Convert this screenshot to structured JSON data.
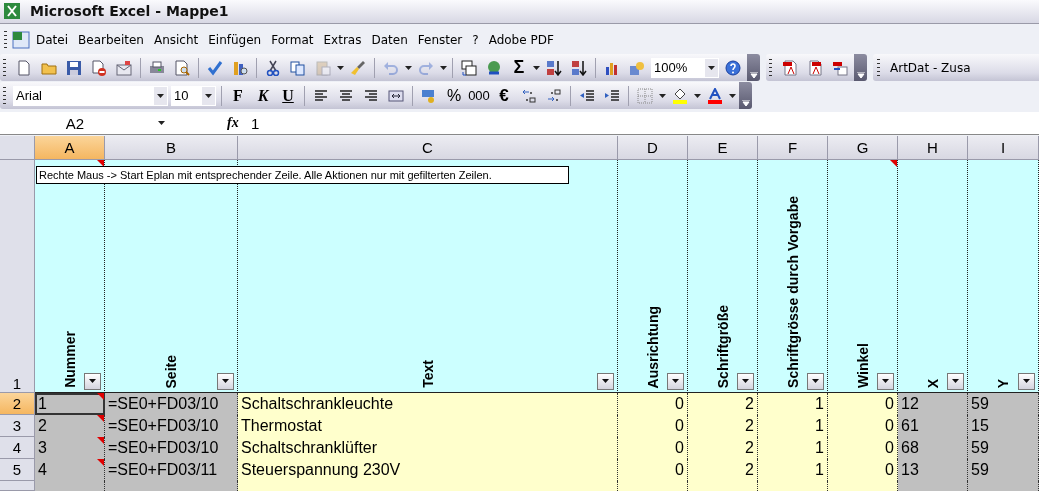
{
  "window": {
    "title": "Microsoft Excel - Mappe1"
  },
  "menu_bar": {
    "items": [
      "Datei",
      "Bearbeiten",
      "Ansicht",
      "Einfügen",
      "Format",
      "Extras",
      "Daten",
      "Fenster",
      "?",
      "Adobe PDF"
    ]
  },
  "standard_toolbar": {
    "disabled": {
      "paste": true,
      "undo": true,
      "redo": true
    },
    "sum_label": "Σ",
    "zoom": "100%"
  },
  "artdat_toolbar": {
    "label": "ArtDat - Zusa"
  },
  "formatting_toolbar": {
    "font": "Arial",
    "size": "10",
    "bold": "F",
    "italic": "K",
    "underline": "U",
    "percent": "%",
    "thousands": "000",
    "euro": "€"
  },
  "formula_bar": {
    "name_box": "A2",
    "fx": "fx",
    "value": "1"
  },
  "sheet": {
    "columns": [
      {
        "letter": "A",
        "selected": true,
        "header": "Nummer",
        "comment": true
      },
      {
        "letter": "B",
        "selected": false,
        "header": "Seite",
        "comment": false
      },
      {
        "letter": "C",
        "selected": false,
        "header": "Text",
        "comment": false
      },
      {
        "letter": "D",
        "selected": false,
        "header": "Ausrichtung",
        "comment": false
      },
      {
        "letter": "E",
        "selected": false,
        "header": "Schriftgröße",
        "comment": false
      },
      {
        "letter": "F",
        "selected": false,
        "header": "Schriftgrösse durch Vorgabe",
        "comment": false
      },
      {
        "letter": "G",
        "selected": false,
        "header": "Winkel",
        "comment": true
      },
      {
        "letter": "H",
        "selected": false,
        "header": "X",
        "comment": false
      },
      {
        "letter": "I",
        "selected": false,
        "header": "Y",
        "comment": false
      }
    ],
    "header_row_number": "1",
    "comment_popup": "Rechte Maus -> Start Eplan mit entsprechender Zeile. Alle Aktionen nur mit gefilterten Zeilen.",
    "rows": [
      {
        "number": "2",
        "selected": true,
        "active_cell": true,
        "comment": true,
        "cells": [
          "1",
          "=SE0+FD03/10",
          "Schaltschrankleuchte",
          "0",
          "2",
          "1",
          "0",
          "12",
          "59"
        ]
      },
      {
        "number": "3",
        "selected": false,
        "active_cell": false,
        "comment": true,
        "cells": [
          "2",
          "=SE0+FD03/10",
          "Thermostat",
          "0",
          "2",
          "1",
          "0",
          "61",
          "15"
        ]
      },
      {
        "number": "4",
        "selected": false,
        "active_cell": false,
        "comment": true,
        "cells": [
          "3",
          "=SE0+FD03/10",
          "Schaltschranklüfter",
          "0",
          "2",
          "1",
          "0",
          "68",
          "59"
        ]
      },
      {
        "number": "5",
        "selected": false,
        "active_cell": false,
        "comment": true,
        "cells": [
          "4",
          "=SE0+FD03/11",
          "Steuerspannung 230V",
          "0",
          "2",
          "1",
          "0",
          "13",
          "59"
        ]
      }
    ]
  }
}
